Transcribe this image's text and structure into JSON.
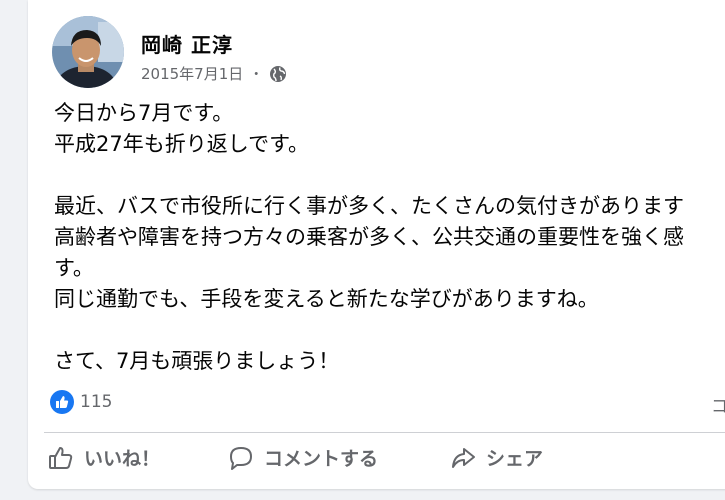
{
  "post": {
    "author": "岡崎 正淳",
    "date": "2015年7月1日",
    "separator": "・",
    "audience_icon": "globe-icon",
    "lines": [
      "今日から7月です。",
      "平成27年も折り返しです。",
      "",
      "最近、バスで市役所に行く事が多く、たくさんの気付きがあります",
      "高齢者や障害を持つ方々の乗客が多く、公共交通の重要性を強く感",
      "す。",
      "同じ通勤でも、手段を変えると新たな学びがありますね。",
      "",
      "さて、7月も頑張りましょう！"
    ]
  },
  "reactions": {
    "count": "115",
    "icon": "like-icon",
    "comments_fragment": "コ"
  },
  "actions": {
    "like_label": "いいね！",
    "comment_label": "コメントする",
    "share_label": "シェア"
  },
  "colors": {
    "accent": "#1877f2",
    "text": "#050505",
    "secondary": "#65676b",
    "divider": "#ced0d4"
  }
}
